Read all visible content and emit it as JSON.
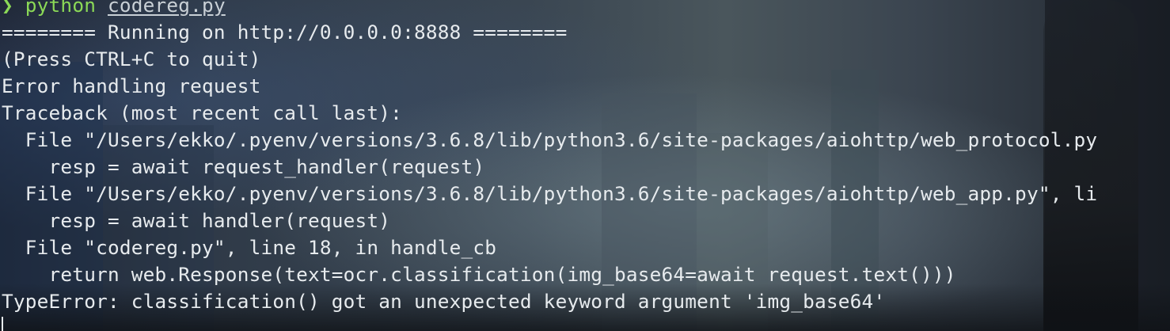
{
  "terminal": {
    "prompt": {
      "symbol": "❯",
      "command": "python",
      "argument": "codereg.py"
    },
    "output_lines": [
      "======== Running on http://0.0.0.0:8888 ========",
      "(Press CTRL+C to quit)",
      "Error handling request",
      "Traceback (most recent call last):",
      "  File \"/Users/ekko/.pyenv/versions/3.6.8/lib/python3.6/site-packages/aiohttp/web_protocol.py",
      "    resp = await request_handler(request)",
      "  File \"/Users/ekko/.pyenv/versions/3.6.8/lib/python3.6/site-packages/aiohttp/web_app.py\", li",
      "    resp = await handler(request)",
      "  File \"codereg.py\", line 18, in handle_cb",
      "    return web.Response(text=ocr.classification(img_base64=await request.text()))",
      "TypeError: classification() got an unexpected keyword argument 'img_base64'"
    ]
  },
  "colors": {
    "prompt_green": "#8bd957",
    "text": "#e7ebee"
  }
}
